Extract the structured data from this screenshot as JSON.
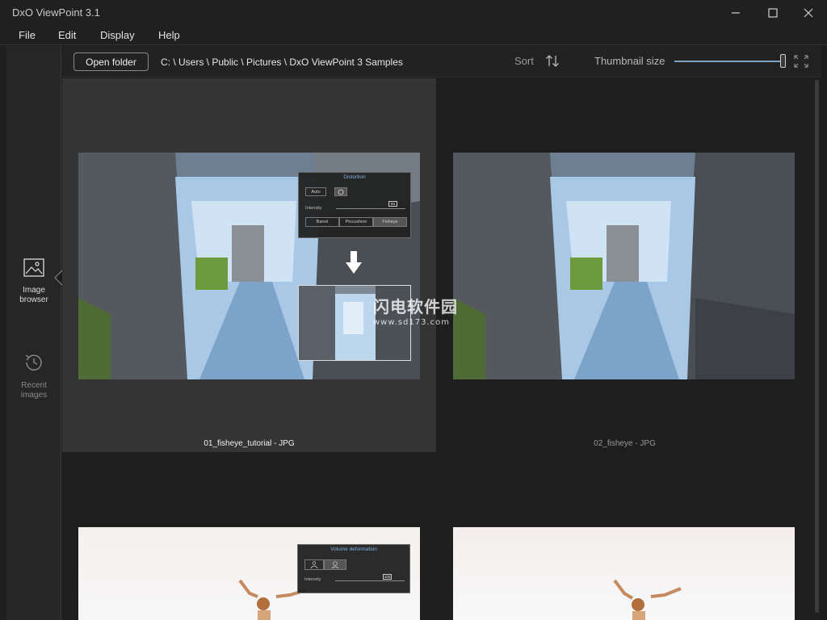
{
  "window": {
    "title": "DxO ViewPoint 3.1"
  },
  "menu": {
    "items": [
      {
        "label": "File"
      },
      {
        "label": "Edit"
      },
      {
        "label": "Display"
      },
      {
        "label": "Help"
      }
    ]
  },
  "sidebar": {
    "items": [
      {
        "label": "Image browser",
        "icon": "image-icon",
        "active": true
      },
      {
        "label": "Recent images",
        "icon": "history-icon",
        "active": false
      }
    ]
  },
  "toolbar": {
    "open_folder": "Open folder",
    "path": "C: \\ Users \\ Public \\ Pictures \\ DxO ViewPoint 3 Samples",
    "sort_label": "Sort",
    "thumbnail_size_label": "Thumbnail size",
    "thumbnail_size_level": 0.98
  },
  "thumbnails": [
    {
      "caption": "01_fisheye_tutorial - JPG",
      "selected": true,
      "panel": {
        "title": "Distortion",
        "auto_label": "Auto",
        "intensity_label": "Intensity",
        "intensity_value": "93",
        "modes": [
          "Barrel",
          "Pincushion",
          "Fisheye"
        ],
        "active_mode": "Fisheye"
      }
    },
    {
      "caption": "02_fisheye - JPG",
      "selected": false
    },
    {
      "caption": "",
      "selected": false,
      "panel": {
        "title": "Volume deformation",
        "intensity_label": "Intensity",
        "intensity_value": "100"
      }
    },
    {
      "caption": "",
      "selected": false
    }
  ],
  "watermark": {
    "line1": "闪电软件园",
    "line2": "www.sd173.com"
  },
  "colors": {
    "accent": "#7da2c6",
    "background": "#1e1e1e",
    "selected_cell": "#343434"
  }
}
